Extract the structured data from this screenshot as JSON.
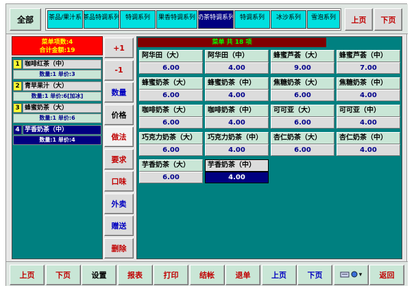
{
  "topbar": {
    "all_label": "全部",
    "categories": [
      {
        "label": "茶品/果汁系",
        "active": false
      },
      {
        "label": "茶品特调系列",
        "active": false
      },
      {
        "label": "特调系列",
        "active": false
      },
      {
        "label": "果香特调系列",
        "active": false
      },
      {
        "label": "奶茶特调系列",
        "active": true
      },
      {
        "label": "特调系列",
        "active": false
      },
      {
        "label": "冰沙系列",
        "active": false
      },
      {
        "label": "雪泡系列",
        "active": false
      }
    ],
    "prev_label": "上页",
    "next_label": "下页"
  },
  "summary": {
    "line1": "菜单项数:4",
    "line2": "合计金额:19"
  },
  "order_items": [
    {
      "num": "1",
      "name": "咖啡红茶（中）",
      "detail": "数量:1 单价:3",
      "selected": false
    },
    {
      "num": "2",
      "name": "青苹果汁（大）",
      "detail": "数量:1 单价:6[加冰]",
      "selected": false
    },
    {
      "num": "3",
      "name": "蜂蜜奶茶（大）",
      "detail": "数量:1 单价:6",
      "selected": false
    },
    {
      "num": "4",
      "name": "芋香奶茶（中）",
      "detail": "数量:1 单价:4",
      "selected": true
    }
  ],
  "functions": [
    {
      "label": "+1",
      "color": "red"
    },
    {
      "label": "-1",
      "color": "red"
    },
    {
      "label": "数量",
      "color": "blue"
    },
    {
      "label": "价格",
      "color": "black"
    },
    {
      "label": "做法",
      "color": "red"
    },
    {
      "label": "要求",
      "color": "red"
    },
    {
      "label": "口味",
      "color": "red"
    },
    {
      "label": "外卖",
      "color": "blue"
    },
    {
      "label": "赠送",
      "color": "blue"
    },
    {
      "label": "删除",
      "color": "red"
    }
  ],
  "menu": {
    "header": "菜单 共 18 项",
    "items": [
      {
        "name": "阿华田（大）",
        "price": "6.00"
      },
      {
        "name": "阿华田（中）",
        "price": "4.00"
      },
      {
        "name": "蜂蜜芦荟（大）",
        "price": "9.00"
      },
      {
        "name": "蜂蜜芦荟（中）",
        "price": "7.00"
      },
      {
        "name": "蜂蜜奶茶（大）",
        "price": "6.00"
      },
      {
        "name": "蜂蜜奶茶（中）",
        "price": "4.00"
      },
      {
        "name": "焦糖奶茶（大）",
        "price": "6.00"
      },
      {
        "name": "焦糖奶茶（中）",
        "price": "4.00"
      },
      {
        "name": "咖啡奶茶（大）",
        "price": "6.00"
      },
      {
        "name": "咖啡奶茶（中）",
        "price": "4.00"
      },
      {
        "name": "可可亚（大）",
        "price": "6.00"
      },
      {
        "name": "可可亚（中）",
        "price": "4.00"
      },
      {
        "name": "巧克力奶茶（大）",
        "price": "6.00"
      },
      {
        "name": "巧克力奶茶（中）",
        "price": "4.00"
      },
      {
        "name": "杏仁奶茶（大）",
        "price": "6.00"
      },
      {
        "name": "杏仁奶茶（中）",
        "price": "4.00"
      },
      {
        "name": "芋香奶茶（大）",
        "price": "6.00"
      },
      {
        "name": "芋香奶茶（中）",
        "price": "4.00"
      }
    ],
    "selected_index": 17
  },
  "bottombar": {
    "buttons": [
      {
        "label": "上页",
        "color": "red"
      },
      {
        "label": "下页",
        "color": "red"
      },
      {
        "label": "设置",
        "color": "black"
      },
      {
        "label": "报表",
        "color": "red"
      },
      {
        "label": "打印",
        "color": "red"
      },
      {
        "label": "结帐",
        "color": "red"
      },
      {
        "label": "退单",
        "color": "red"
      },
      {
        "label": "上页",
        "color": "blue"
      },
      {
        "label": "下页",
        "color": "blue"
      },
      {
        "label": "",
        "color": "black",
        "icons": [
          "keyboard-icon",
          "globe-icon",
          "dropdown-icon"
        ]
      },
      {
        "label": "返回",
        "color": "red"
      }
    ]
  }
}
